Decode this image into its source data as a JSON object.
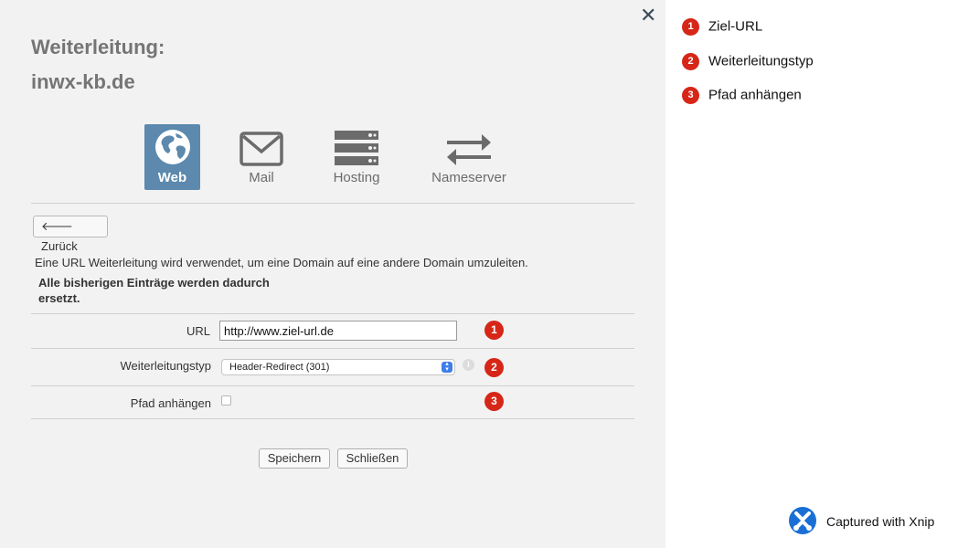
{
  "dialog": {
    "title_line1": "Weiterleitung:",
    "title_line2": "inwx-kb.de",
    "close_label": "✕"
  },
  "tabs": [
    {
      "label": "Web",
      "icon": "globe-icon",
      "active": true
    },
    {
      "label": "Mail",
      "icon": "envelope-icon",
      "active": false
    },
    {
      "label": "Hosting",
      "icon": "server-icon",
      "active": false
    },
    {
      "label": "Nameserver",
      "icon": "exchange-arrows-icon",
      "active": false
    }
  ],
  "back_button": {
    "label": "Zurück",
    "icon": "arrow-left-icon"
  },
  "description": "Eine URL Weiterleitung wird verwendet, um eine Domain auf eine andere Domain umzuleiten.",
  "warning_line1": "Alle bisherigen Einträge werden dadurch",
  "warning_line2": "ersetzt.",
  "form": {
    "url_label": "URL",
    "url_value": "http://www.ziel-url.de",
    "type_label": "Weiterleitungstyp",
    "type_value": "Header-Redirect (301)",
    "path_label": "Pfad anhängen",
    "path_checked": false
  },
  "buttons": {
    "save": "Speichern",
    "close": "Schließen"
  },
  "badges": [
    "1",
    "2",
    "3"
  ],
  "legend": [
    {
      "number": "1",
      "label": "Ziel-URL"
    },
    {
      "number": "2",
      "label": "Weiterleitungstyp"
    },
    {
      "number": "3",
      "label": "Pfad anhängen"
    }
  ],
  "watermark": "Captured with Xnip",
  "colors": {
    "accent": "#5c89ad",
    "badge": "#d62618",
    "dialog_bg": "#f2f2f2"
  }
}
